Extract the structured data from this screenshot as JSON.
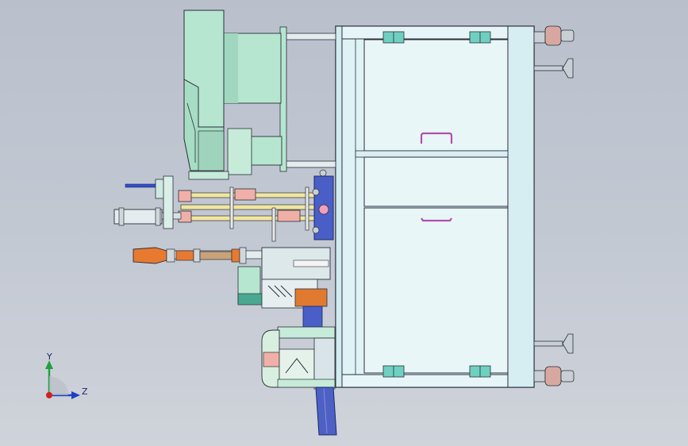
{
  "viewport": {
    "background_top": "#b9c0cc",
    "background_bottom": "#cfd3da"
  },
  "triad": {
    "y_label": "Y",
    "z_label": "Z",
    "y_color": "#22a040",
    "z_color": "#2040c0",
    "origin_color": "#d02020"
  },
  "colors": {
    "cabinet_frame": "#dff3f6",
    "cabinet_edge": "#2a2f3a",
    "panel_fill": "#e9f6f8",
    "hinge": "#6fcfc0",
    "fan_body": "#b6e6cf",
    "fan_dark": "#8fcfb4",
    "rod_pink": "#f0b0a8",
    "rod_yellow": "#f1e6a0",
    "blue_block": "#4a5ec8",
    "orange_part": "#e87a30",
    "handle": "#b050b0",
    "caster_wheel": "#d8a8a0",
    "foot": "#c8d0d6",
    "chute": "#4d60c4"
  }
}
